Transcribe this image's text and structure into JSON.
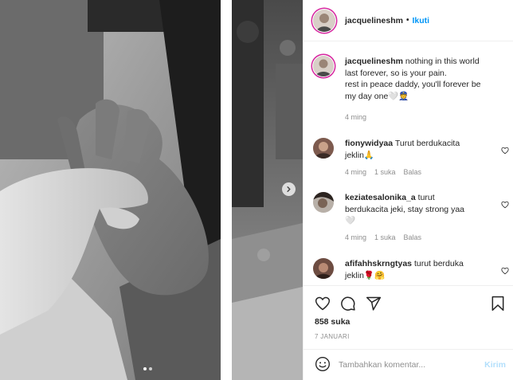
{
  "post": {
    "username": "jacquelineshm",
    "follow_label": "Ikuti",
    "caption_lines": [
      "nothing in this world",
      "last forever, so is your pain.",
      "rest in peace daddy, you'll forever be",
      "my day one🤍👮"
    ],
    "caption_time": "4 ming",
    "likes": "858 suka",
    "date": "7 JANUARI"
  },
  "comments": [
    {
      "username": "fionywidyaa",
      "lines": [
        "Turut berdukacita",
        "jeklin🙏"
      ],
      "time": "4 ming",
      "likes": "1 suka",
      "reply": "Balas"
    },
    {
      "username": "keziatesalonika_a",
      "lines": [
        "turut",
        "berdukacita jeki, stay strong yaa",
        "🤍"
      ],
      "time": "4 ming",
      "likes": "1 suka",
      "reply": "Balas"
    },
    {
      "username": "afifahhskrngtyas",
      "lines": [
        "turut berduka",
        "jeklin🌹🤗"
      ]
    }
  ],
  "compose": {
    "placeholder": "Tambahkan komentar...",
    "post_label": "Kirim"
  },
  "icons": [
    "heart-icon",
    "comment-icon",
    "share-icon",
    "bookmark-icon",
    "emoji-icon",
    "chevron-right-icon"
  ],
  "colors": {
    "accent": "#0095f6",
    "post_disabled": "#b2dffc",
    "story_ring": "#d6249f"
  },
  "carousel": {
    "count": 2,
    "active_index": 0
  }
}
